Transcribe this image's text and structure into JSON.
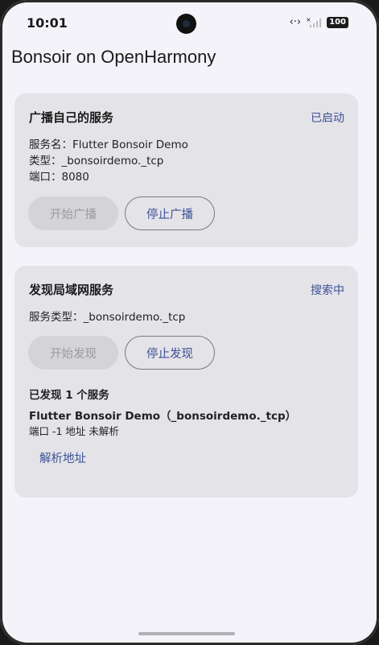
{
  "status_bar": {
    "time": "10:01",
    "network_glyph": "‹·›",
    "battery": "100"
  },
  "app": {
    "title": "Bonsoir on OpenHarmony"
  },
  "broadcast": {
    "title": "广播自己的服务",
    "status": "已启动",
    "service_name_line": "服务名：Flutter Bonsoir Demo",
    "type_line": "类型：_bonsoirdemo._tcp",
    "port_line": "端口：8080",
    "start_label": "开始广播",
    "stop_label": "停止广播"
  },
  "discovery": {
    "title": "发现局域网服务",
    "status": "搜索中",
    "service_type_line": "服务类型：_bonsoirdemo._tcp",
    "start_label": "开始发现",
    "stop_label": "停止发现",
    "found_count_line": "已发现 1 个服务",
    "service": {
      "name_line": "Flutter Bonsoir Demo（_bonsoirdemo._tcp）",
      "detail_line": "端口 -1    地址 未解析",
      "resolve_label": "解析地址"
    }
  },
  "colors": {
    "accent": "#3d5196",
    "card_bg": "#e4e3e8",
    "page_bg": "#f4f3f9"
  }
}
